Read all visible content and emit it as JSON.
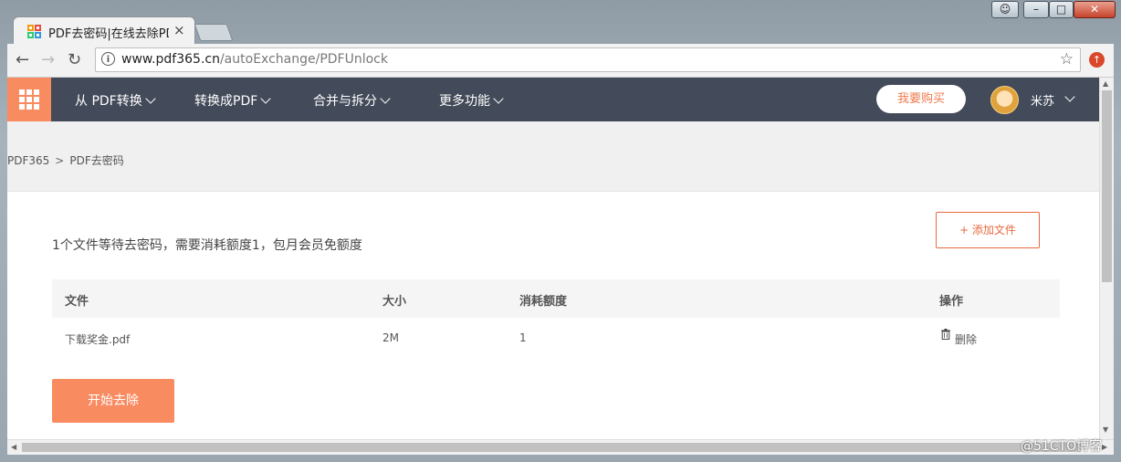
{
  "window": {
    "user_icon": "user-icon",
    "min": "–",
    "max": "□",
    "close": "✕"
  },
  "tab": {
    "title": "PDF去密码|在线去除PDF",
    "close": "×"
  },
  "toolbar": {
    "back": "←",
    "forward": "→",
    "reload": "↻",
    "info": "i",
    "url_host": "www.pdf365.cn",
    "url_path": "/autoExchange/PDFUnlock",
    "star": "☆",
    "ext": "↑"
  },
  "nav": {
    "menu": [
      "从 PDF转换",
      "转换成PDF",
      "合并与拆分",
      "更多功能"
    ],
    "buy": "我要购买",
    "username": "米苏"
  },
  "breadcrumb": {
    "home": "PDF365",
    "sep": ">",
    "current": "PDF去密码"
  },
  "main": {
    "note": "1个文件等待去密码，需要消耗额度1，包月会员免额度",
    "add_file": "+ 添加文件",
    "columns": [
      "文件",
      "大小",
      "消耗额度",
      "操作"
    ],
    "rows": [
      {
        "file": "下载奖金.pdf",
        "size": "2M",
        "cost": "1",
        "action": "删除"
      }
    ],
    "start": "开始去除"
  },
  "watermark": "@51CTO博客",
  "colors": {
    "accent": "#f98b61",
    "nav_bg": "#434a59",
    "add_border": "#e8693f"
  }
}
